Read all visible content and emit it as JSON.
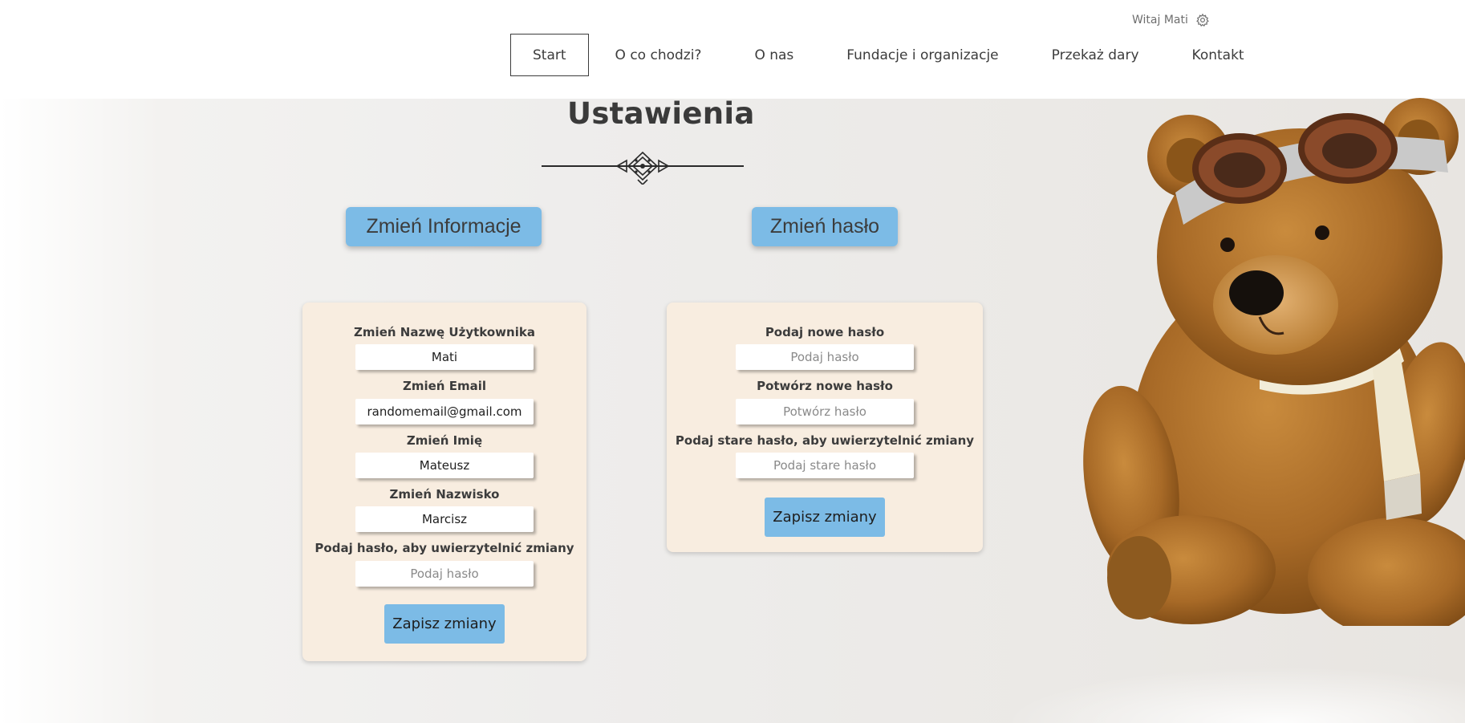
{
  "header": {
    "greeting": "Witaj Mati",
    "nav": [
      {
        "label": "Start",
        "active": true
      },
      {
        "label": "O co chodzi?"
      },
      {
        "label": "O nas"
      },
      {
        "label": "Fundacje i organizacje"
      },
      {
        "label": "Przekaż dary"
      },
      {
        "label": "Kontakt"
      }
    ],
    "settings_icon": "gear-icon"
  },
  "page": {
    "title": "Ustawienia"
  },
  "info_section": {
    "button_label": "Zmień Informacje",
    "fields": [
      {
        "label": "Zmień Nazwę Użytkownika",
        "value": "Mati",
        "placeholder": ""
      },
      {
        "label": "Zmień Email",
        "value": "randomemail@gmail.com",
        "placeholder": ""
      },
      {
        "label": "Zmień Imię",
        "value": "Mateusz",
        "placeholder": ""
      },
      {
        "label": "Zmień Nazwisko",
        "value": "Marcisz",
        "placeholder": ""
      },
      {
        "label": "Podaj hasło, aby uwierzytelnić zmiany",
        "value": "",
        "placeholder": "Podaj hasło"
      }
    ],
    "save_label": "Zapisz zmiany"
  },
  "password_section": {
    "button_label": "Zmień hasło",
    "fields": [
      {
        "label": "Podaj nowe hasło",
        "value": "",
        "placeholder": "Podaj hasło"
      },
      {
        "label": "Potwórz nowe hasło",
        "value": "",
        "placeholder": "Potwórz hasło"
      },
      {
        "label": "Podaj stare hasło, aby uwierzytelnić zmiany",
        "value": "",
        "placeholder": "Podaj stare hasło"
      }
    ],
    "save_label": "Zapisz zmiany"
  },
  "colors": {
    "accent": "#7cbbe6",
    "card": "#f8ede0",
    "text": "#3c3c3c"
  }
}
